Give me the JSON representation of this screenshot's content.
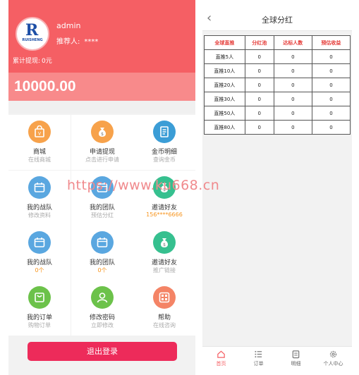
{
  "left": {
    "username": "admin",
    "referrer_label": "推荐人:",
    "referrer_value": "****",
    "withdrawn_label": "累计提现:",
    "withdrawn_value": "0元",
    "balance": "10000.00",
    "brand_logo_text": "RUISHENG",
    "colors": {
      "header": "#f55f64",
      "balance_bar": "#f88a8b",
      "logout": "#ed2b5a"
    },
    "grid": [
      {
        "label": "商城",
        "sub": "在线商城",
        "icon": "shop-bag-icon",
        "color": "#f7a24b"
      },
      {
        "label": "申请提现",
        "sub": "点击进行申请",
        "icon": "money-bag-icon",
        "color": "#f7a24b"
      },
      {
        "label": "金币明细",
        "sub": "查询金币",
        "icon": "document-list-icon",
        "color": "#3b9dd6"
      },
      {
        "label": "我的战队",
        "sub": "修改资料",
        "icon": "calendar-icon",
        "color": "#5aa7e0"
      },
      {
        "label": "我的团队",
        "sub": "预估分红",
        "icon": "calendar-icon",
        "color": "#5aa7e0"
      },
      {
        "label": "邀请好友",
        "sub": "156****6666",
        "icon": "money-bag-icon",
        "color": "#36c08f"
      },
      {
        "label": "我的战队",
        "sub": "0个",
        "icon": "calendar-icon",
        "color": "#5aa7e0"
      },
      {
        "label": "我的团队",
        "sub": "0个",
        "icon": "calendar-icon",
        "color": "#5aa7e0"
      },
      {
        "label": "邀请好友",
        "sub": "推广链接",
        "icon": "money-bag-icon",
        "color": "#36c08f"
      },
      {
        "label": "我的订单",
        "sub": "购物订单",
        "icon": "shopping-bag-icon",
        "color": "#6cc24a"
      },
      {
        "label": "修改密码",
        "sub": "立即修改",
        "icon": "user-icon",
        "color": "#6cc24a"
      },
      {
        "label": "帮助",
        "sub": "在线咨询",
        "icon": "grid-help-icon",
        "color": "#f48466"
      }
    ],
    "logout_label": "退出登录"
  },
  "right": {
    "title": "全球分红",
    "table": {
      "headers": [
        "全球直推",
        "分红池",
        "达标人数",
        "预估收益"
      ],
      "rows": [
        [
          "直推5人",
          "0",
          "0",
          "0"
        ],
        [
          "直推10人",
          "0",
          "0",
          "0"
        ],
        [
          "直推20人",
          "0",
          "0",
          "0"
        ],
        [
          "直推30人",
          "0",
          "0",
          "0"
        ],
        [
          "直推50人",
          "0",
          "0",
          "0"
        ],
        [
          "直推80人",
          "0",
          "0",
          "0"
        ]
      ]
    },
    "tabs": [
      {
        "label": "首页",
        "icon": "home-icon",
        "active": true
      },
      {
        "label": "订单",
        "icon": "list-icon",
        "active": false
      },
      {
        "label": "明细",
        "icon": "detail-icon",
        "active": false
      },
      {
        "label": "个人中心",
        "icon": "gear-icon",
        "active": false
      }
    ]
  },
  "watermark": "https://www.ku668.cn"
}
